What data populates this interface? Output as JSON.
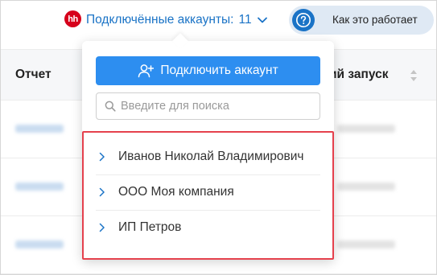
{
  "topbar": {
    "logo_text": "hh",
    "accounts_label": "Подключённые аккаунты:",
    "accounts_count": "11",
    "help_label": "Как это работает"
  },
  "table": {
    "col_report": "Отчет",
    "col_last_run": "ий запуск"
  },
  "dropdown": {
    "connect_button": "Подключить аккаунт",
    "search_placeholder": "Введите для поиска",
    "accounts": [
      {
        "label": "Иванов Николай Владимирович"
      },
      {
        "label": "ООО Моя компания"
      },
      {
        "label": "ИП Петров"
      }
    ]
  },
  "colors": {
    "accent": "#1a73c6",
    "button": "#2d8ef0",
    "highlight": "#e5414d",
    "hh_brand": "#d6001c"
  }
}
